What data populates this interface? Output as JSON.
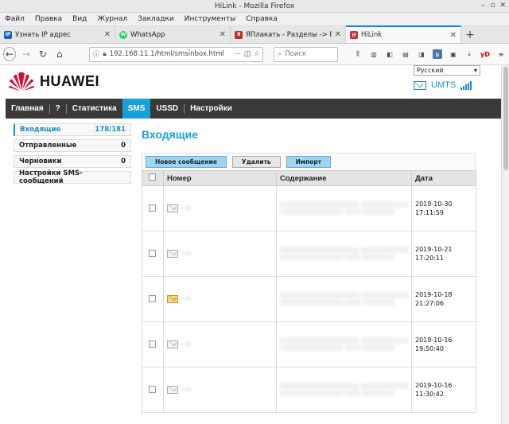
{
  "window": {
    "title": "HiLink - Mozilla Firefox"
  },
  "menu": [
    "Файл",
    "Правка",
    "Вид",
    "Журнал",
    "Закладки",
    "Инструменты",
    "Справка"
  ],
  "tabs": [
    {
      "label": "Узнать IP адрес",
      "icon": "IP",
      "color": "#1565c0"
    },
    {
      "label": "WhatsApp",
      "icon": "W",
      "color": "#25d366"
    },
    {
      "label": "ЯПлакать - Разделы -> Редакт",
      "icon": "Я",
      "color": "#c62828"
    },
    {
      "label": "HiLink",
      "icon": "H",
      "color": "#d32f2f"
    }
  ],
  "urlbar": {
    "url": "192.168.11.1/html/smsinbox.html"
  },
  "search": {
    "placeholder": "Поиск"
  },
  "brand": {
    "name": "HUAWEI",
    "color": "#cf0a2c"
  },
  "language": "Русский",
  "network": "UMTS",
  "nav": [
    "Главная",
    "?",
    "Статистика",
    "SMS",
    "USSD",
    "Настройки"
  ],
  "nav_active": 3,
  "sidebar": [
    {
      "label": "Входящие",
      "count": "178/181"
    },
    {
      "label": "Отправленные",
      "count": "0"
    },
    {
      "label": "Черновики",
      "count": "0"
    },
    {
      "label": "Настройки SMS-сообщений",
      "count": ""
    }
  ],
  "content": {
    "title": "Входящие",
    "buttons": {
      "new": "Новое сообщение",
      "delete": "Удалить",
      "import": "Импорт"
    },
    "columns": {
      "number": "Номер",
      "content": "Содержание",
      "date": "Дата"
    }
  },
  "messages": [
    {
      "number": "",
      "content": "",
      "date": "2019-10-30 17:11:59",
      "opened": false
    },
    {
      "number": "",
      "content": "",
      "date": "2019-10-21 17:20:11",
      "opened": false
    },
    {
      "number": "",
      "content": "",
      "date": "2019-10-18 21:27:06",
      "opened": true
    },
    {
      "number": "",
      "content": "",
      "date": "2019-10-16 19:50:40",
      "opened": false
    },
    {
      "number": "",
      "content": "",
      "date": "2019-10-16 11:30:42",
      "opened": false
    }
  ]
}
